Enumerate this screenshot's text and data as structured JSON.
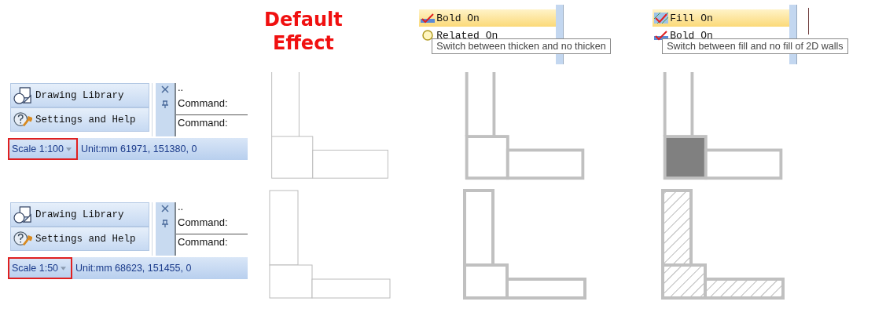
{
  "heading": "Default Effect",
  "menus": [
    {
      "items": [
        {
          "label": "Bold On",
          "selected": true,
          "kind": "check"
        },
        {
          "label": "Related On",
          "selected": false,
          "kind": "bulb"
        }
      ],
      "tooltip": "Switch between thicken and no thicken"
    },
    {
      "items": [
        {
          "label": "Fill On",
          "selected": true,
          "kind": "hatch-check"
        },
        {
          "label": "Bold On",
          "selected": false,
          "kind": "check"
        }
      ],
      "tooltip": "Switch between fill and no fill of 2D walls"
    }
  ],
  "rows": [
    {
      "panel": {
        "buttons": [
          {
            "label": "Drawing Library",
            "kind": "shapes"
          },
          {
            "label": "Settings and Help",
            "kind": "help"
          }
        ],
        "console_lines": [
          "..",
          "Command:",
          "Command:"
        ],
        "scale": {
          "label": "Scale 1:100",
          "highlighted": true
        },
        "status": "Unit:mm  61971, 151380, 0"
      },
      "kind": "open",
      "drawings": [
        {
          "kind": "thin"
        },
        {
          "kind": "bold"
        },
        {
          "kind": "solid"
        }
      ]
    },
    {
      "panel": {
        "buttons": [
          {
            "label": "Drawing Library",
            "kind": "shapes"
          },
          {
            "label": "Settings and Help",
            "kind": "help"
          }
        ],
        "console_lines": [
          "..",
          "Command:",
          "Command:"
        ],
        "scale": {
          "label": "Scale 1:50",
          "highlighted": true
        },
        "status": "Unit:mm  68623, 151455, 0"
      },
      "kind": "closed",
      "drawings": [
        {
          "kind": "thin"
        },
        {
          "kind": "bold"
        },
        {
          "kind": "hatch"
        }
      ]
    }
  ]
}
